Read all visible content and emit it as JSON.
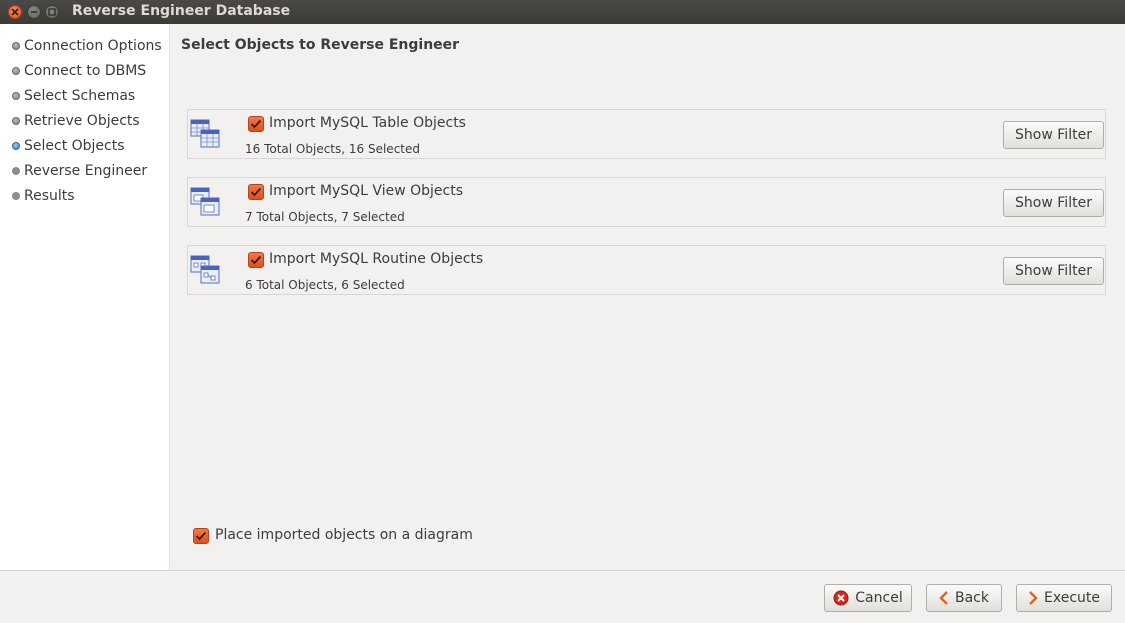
{
  "window": {
    "title": "Reverse Engineer Database"
  },
  "sidebar": {
    "steps": [
      {
        "label": "Connection Options",
        "state": "done"
      },
      {
        "label": "Connect to DBMS",
        "state": "done"
      },
      {
        "label": "Select Schemas",
        "state": "done"
      },
      {
        "label": "Retrieve Objects",
        "state": "done"
      },
      {
        "label": "Select Objects",
        "state": "current"
      },
      {
        "label": "Reverse Engineer",
        "state": "pending"
      },
      {
        "label": "Results",
        "state": "pending"
      }
    ]
  },
  "main": {
    "title": "Select Objects to Reverse Engineer",
    "groups": [
      {
        "icon": "table-objects-icon",
        "label": "Import MySQL Table Objects",
        "checked": true,
        "summary": "16 Total Objects, 16 Selected",
        "filter_label": "Show Filter"
      },
      {
        "icon": "view-objects-icon",
        "label": "Import MySQL View Objects",
        "checked": true,
        "summary": "7 Total Objects, 7 Selected",
        "filter_label": "Show Filter"
      },
      {
        "icon": "routine-objects-icon",
        "label": "Import MySQL Routine Objects",
        "checked": true,
        "summary": "6 Total Objects, 6 Selected",
        "filter_label": "Show Filter"
      }
    ],
    "place_on_diagram": {
      "label": "Place imported objects on a diagram",
      "checked": true
    }
  },
  "footer": {
    "cancel_label": "Cancel",
    "back_label": "Back",
    "execute_label": "Execute"
  },
  "colors": {
    "accent_orange": "#df4f1d",
    "current_step_blue": "#3d7fbf",
    "titlebar": "#3c3b37"
  }
}
